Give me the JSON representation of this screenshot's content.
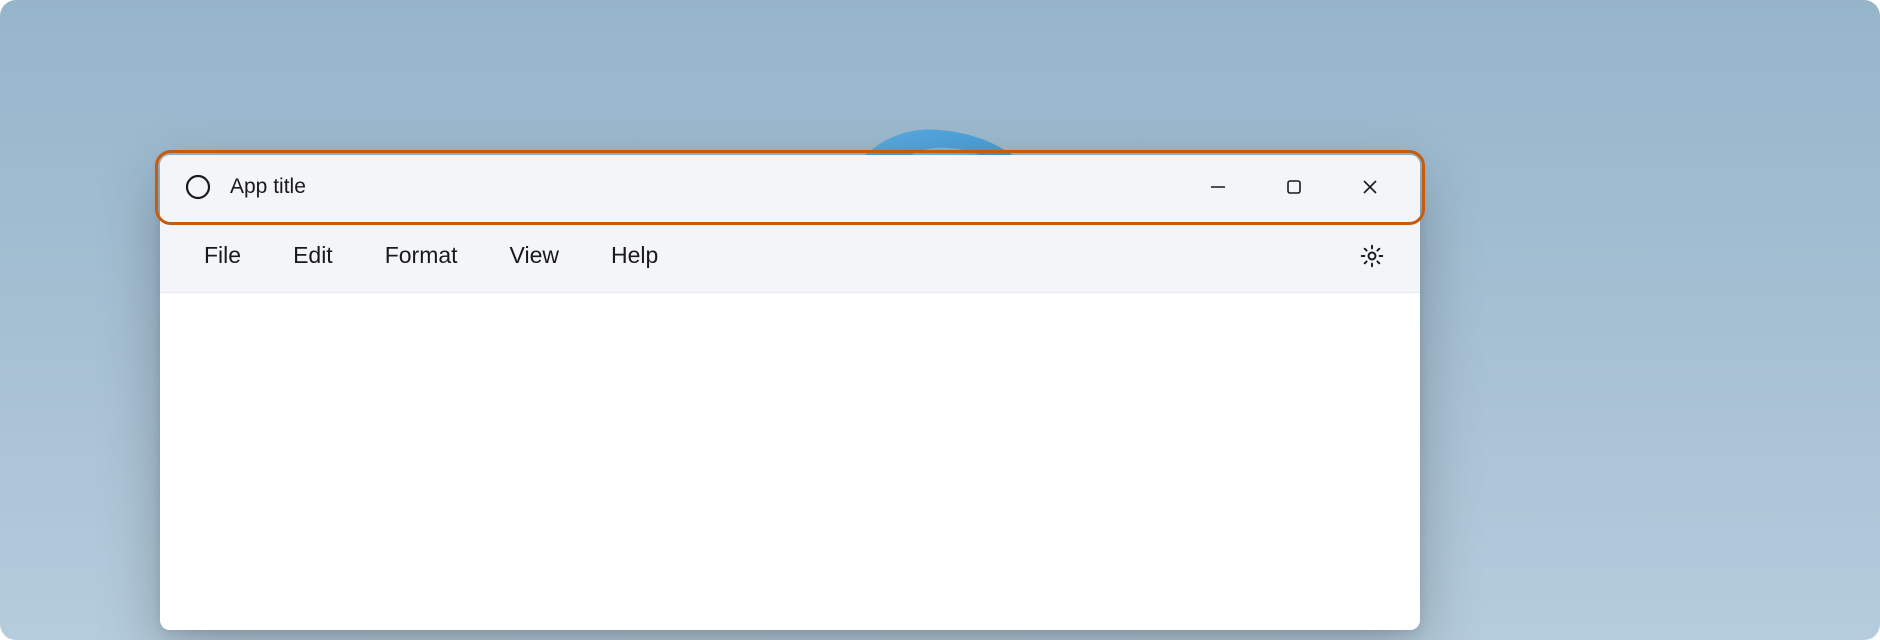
{
  "titlebar": {
    "app_title": "App title",
    "icon_name": "app-icon"
  },
  "window_controls": {
    "minimize": "minimize",
    "maximize": "maximize",
    "close": "close"
  },
  "menubar": {
    "items": [
      {
        "label": "File"
      },
      {
        "label": "Edit"
      },
      {
        "label": "Format"
      },
      {
        "label": "View"
      },
      {
        "label": "Help"
      }
    ],
    "settings_icon": "settings"
  },
  "colors": {
    "highlight_border": "#c75c0e",
    "background_gradient_start": "#96b5cb",
    "background_gradient_end": "#b5ccdc",
    "window_bg": "#f9f9fb",
    "titlebar_bg": "#f3f5f8"
  }
}
